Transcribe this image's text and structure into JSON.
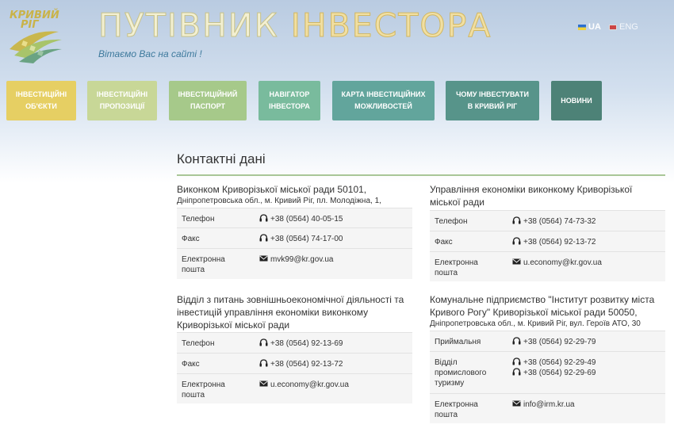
{
  "header": {
    "logo_line1": "КРИВИЙ",
    "logo_line2": "РІГ",
    "title_part1": "ПУТІВНИК ",
    "title_part2": "ІНВЕСТОРА",
    "tagline": "Вітаємо Вас на сайті !",
    "lang_ua": "UA",
    "lang_en": "ENG"
  },
  "nav": [
    {
      "line1": "ІНВЕСТИЦІЙНІ",
      "line2": "ОБ'ЄКТИ",
      "color": "#e6cf63"
    },
    {
      "line1": "ІНВЕСТИЦІЙНІ",
      "line2": "ПРОПОЗИЦІЇ",
      "color": "#c8d797"
    },
    {
      "line1": "ІНВЕСТИЦІЙНИЙ",
      "line2": "ПАСПОРТ",
      "color": "#a6c98a"
    },
    {
      "line1": "НАВІГАТОР",
      "line2": "ІНВЕСТОРА",
      "color": "#79bb9d"
    },
    {
      "line1": "КАРТА ІНВЕСТИЦІЙНИХ",
      "line2": "МОЖЛИВОСТЕЙ",
      "color": "#62a59c"
    },
    {
      "line1": "ЧОМУ ІНВЕСТУВАТИ",
      "line2": "В КРИВИЙ РІГ",
      "color": "#57948a"
    },
    {
      "line1": "НОВИНИ",
      "line2": "",
      "color": "#4d8277"
    }
  ],
  "page_title": "Контактні дані",
  "blocks": [
    {
      "title": "Виконком Криворізької міської ради 50101,",
      "address": "Дніпропетровська обл., м. Кривий Ріг, пл. Молодіжна, 1,",
      "rows": [
        {
          "label": "Телефон",
          "values": [
            "+38 (0564) 40-05-15"
          ],
          "icon": "phone-icon"
        },
        {
          "label": "Факс",
          "values": [
            "+38 (0564) 74-17-00"
          ],
          "icon": "phone-icon"
        },
        {
          "label": "Електронна пошта",
          "values": [
            "mvk99@kr.gov.ua"
          ],
          "icon": "mail-icon"
        }
      ]
    },
    {
      "title": "Управління економіки виконкому Криворізької міської ради",
      "address": "",
      "rows": [
        {
          "label": "Телефон",
          "values": [
            "+38 (0564) 74-73-32"
          ],
          "icon": "phone-icon"
        },
        {
          "label": "Факс",
          "values": [
            "+38 (0564) 92-13-72"
          ],
          "icon": "phone-icon"
        },
        {
          "label": "Електронна пошта",
          "values": [
            "u.economy@kr.gov.ua"
          ],
          "icon": "mail-icon"
        }
      ]
    },
    {
      "title": "Відділ з питань зовнішньоекономічної діяльності та інвестицій управління економіки виконкому Криворізької міської ради",
      "address": "",
      "rows": [
        {
          "label": "Телефон",
          "values": [
            "+38 (0564) 92-13-69"
          ],
          "icon": "phone-icon"
        },
        {
          "label": "Факс",
          "values": [
            "+38 (0564) 92-13-72"
          ],
          "icon": "phone-icon"
        },
        {
          "label": "Електронна пошта",
          "values": [
            "u.economy@kr.gov.ua"
          ],
          "icon": "mail-icon"
        }
      ]
    },
    {
      "title": "Комунальне підприємство \"Інститут розвитку міста Кривого Рогу\" Криворізької міської ради 50050,",
      "address": "Дніпропетровська обл., м. Кривий Ріг, вул. Героїв АТО, 30",
      "rows": [
        {
          "label": "Приймальня",
          "values": [
            "+38 (0564) 92-29-79"
          ],
          "icon": "phone-icon"
        },
        {
          "label": "Відділ промислового туризму",
          "values": [
            "+38 (0564) 92-29-49",
            "+38 (0564) 92-29-69"
          ],
          "icon": "phone-icon"
        },
        {
          "label": "Електронна пошта",
          "values": [
            "info@irm.kr.ua"
          ],
          "icon": "mail-icon"
        }
      ]
    }
  ]
}
